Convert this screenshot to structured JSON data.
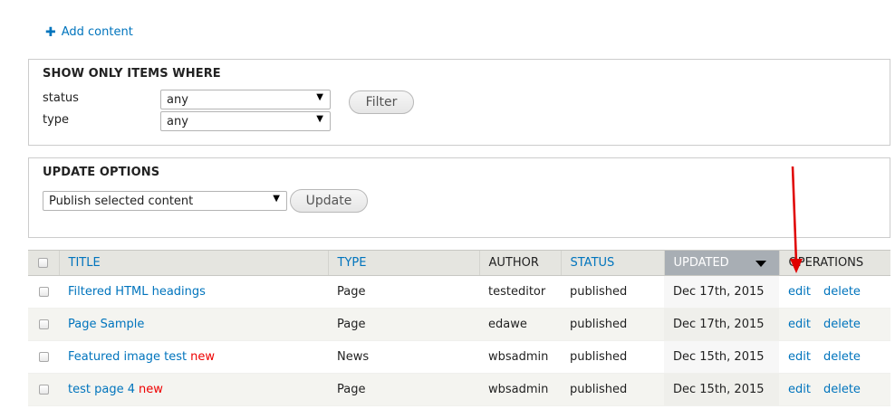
{
  "actions": {
    "add_content": "Add content"
  },
  "filter": {
    "legend": "SHOW ONLY ITEMS WHERE",
    "status_label": "status",
    "status_value": "any",
    "type_label": "type",
    "type_value": "any",
    "filter_button": "Filter"
  },
  "update": {
    "legend": "UPDATE OPTIONS",
    "operation_value": "Publish selected content",
    "update_button": "Update"
  },
  "table": {
    "headers": {
      "title": "TITLE",
      "type": "TYPE",
      "author": "AUTHOR",
      "status": "STATUS",
      "updated": "UPDATED",
      "operations": "OPERATIONS"
    },
    "rows": [
      {
        "title": "Filtered HTML headings",
        "new": "",
        "type": "Page",
        "author": "testeditor",
        "status": "published",
        "updated": "Dec 17th, 2015",
        "edit": "edit",
        "delete": "delete"
      },
      {
        "title": "Page Sample",
        "new": "",
        "type": "Page",
        "author": "edawe",
        "status": "published",
        "updated": "Dec 17th, 2015",
        "edit": "edit",
        "delete": "delete"
      },
      {
        "title": "Featured image test",
        "new": "new",
        "type": "News",
        "author": "wbsadmin",
        "status": "published",
        "updated": "Dec 15th, 2015",
        "edit": "edit",
        "delete": "delete"
      },
      {
        "title": "test page 4",
        "new": "new",
        "type": "Page",
        "author": "wbsadmin",
        "status": "published",
        "updated": "Dec 15th, 2015",
        "edit": "edit",
        "delete": "delete"
      }
    ]
  },
  "colors": {
    "link": "#0074bd",
    "new_marker": "#e00000",
    "annotation_arrow": "#e00000",
    "active_header": "#a8aeb4"
  }
}
